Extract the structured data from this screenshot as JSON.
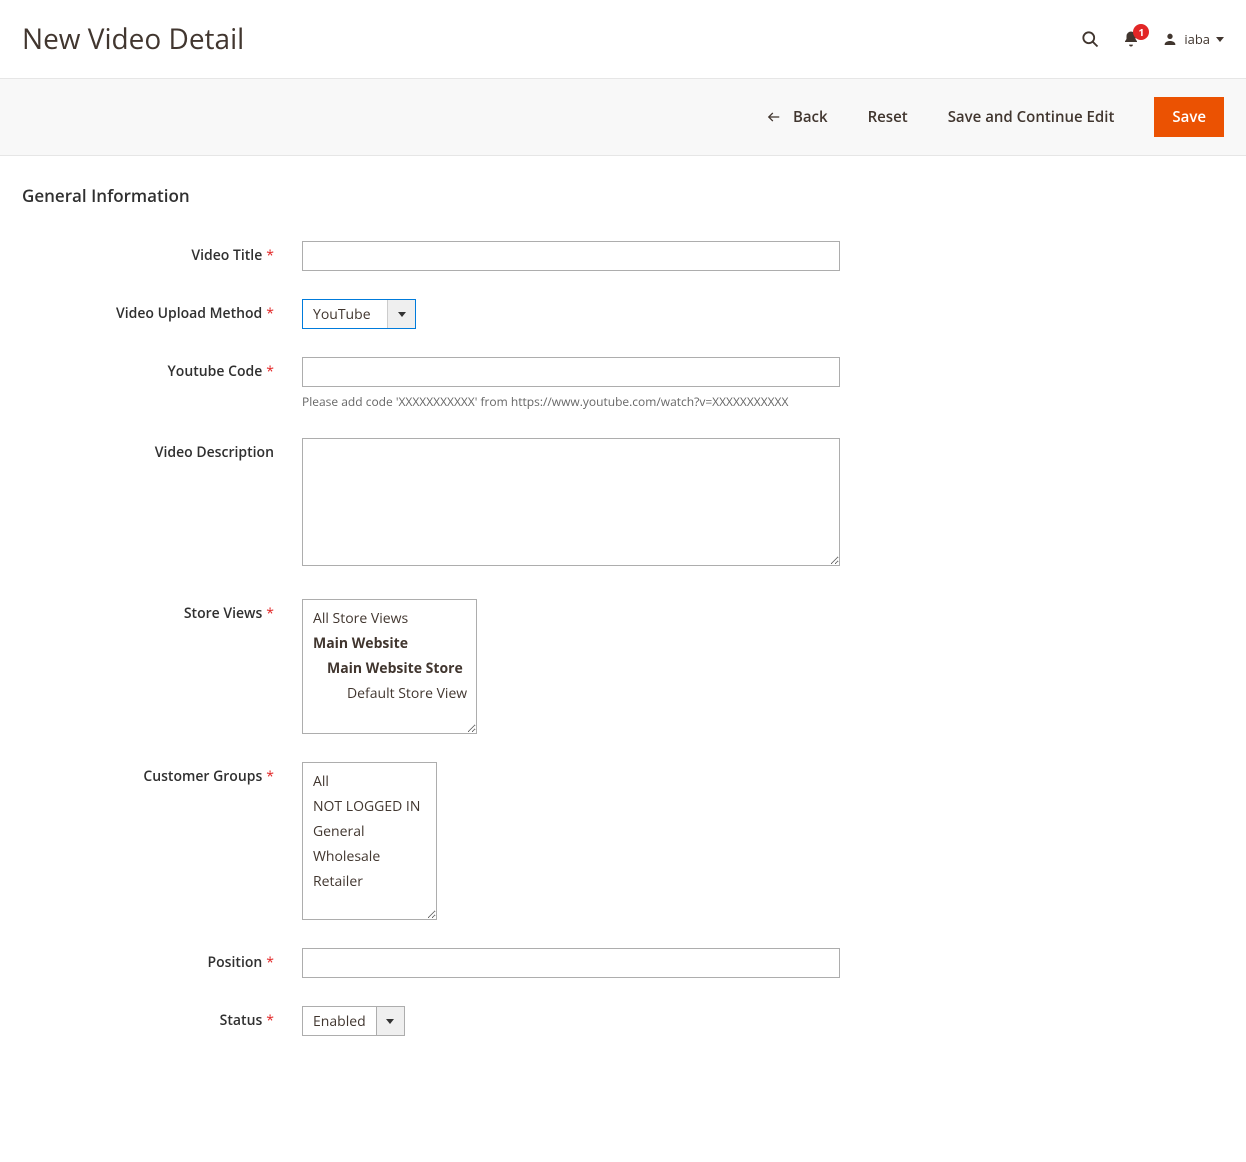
{
  "header": {
    "page_title": "New Video Detail",
    "notification_count": "1",
    "user_name": "iaba"
  },
  "actions": {
    "back": "Back",
    "reset": "Reset",
    "save_continue": "Save and Continue Edit",
    "save": "Save"
  },
  "section_title": "General Information",
  "fields": {
    "video_title": {
      "label": "Video Title",
      "value": ""
    },
    "upload_method": {
      "label": "Video Upload Method",
      "value": "YouTube"
    },
    "youtube_code": {
      "label": "Youtube Code",
      "value": "",
      "hint": "Please add code 'XXXXXXXXXXX' from https://www.youtube.com/watch?v=XXXXXXXXXXX"
    },
    "video_description": {
      "label": "Video Description",
      "value": ""
    },
    "store_views": {
      "label": "Store Views",
      "options": [
        {
          "label": "All Store Views",
          "bold": false,
          "indent": 0
        },
        {
          "label": "Main Website",
          "bold": true,
          "indent": 0
        },
        {
          "label": "Main Website Store",
          "bold": true,
          "indent": 1
        },
        {
          "label": "Default Store View",
          "bold": false,
          "indent": 2
        }
      ]
    },
    "customer_groups": {
      "label": "Customer Groups",
      "options": [
        "All",
        "NOT LOGGED IN",
        "General",
        "Wholesale",
        "Retailer"
      ]
    },
    "position": {
      "label": "Position",
      "value": ""
    },
    "status": {
      "label": "Status",
      "value": "Enabled"
    }
  }
}
